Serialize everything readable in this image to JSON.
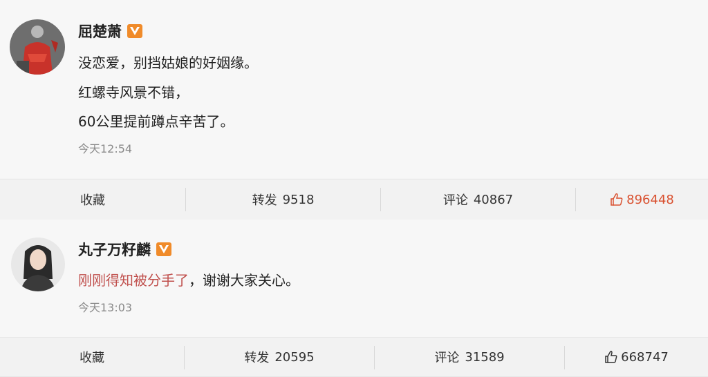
{
  "posts": [
    {
      "username": "屈楚萧",
      "lines": [
        "没恋爱，别挡姑娘的好姻缘。",
        "红螺寺风景不错，",
        "60公里提前蹲点辛苦了。"
      ],
      "time": "今天12:54",
      "actions": {
        "favorite": "收藏",
        "repost_label": "转发",
        "repost_count": "9518",
        "comment_label": "评论",
        "comment_count": "40867",
        "like_count": "896448"
      }
    },
    {
      "username": "丸子万籽麟",
      "line_highlight": "刚刚得知被分手了",
      "line_rest": "，谢谢大家关心。",
      "time": "今天13:03",
      "actions": {
        "favorite": "收藏",
        "repost_label": "转发",
        "repost_count": "20595",
        "comment_label": "评论",
        "comment_count": "31589",
        "like_count": "668747"
      }
    }
  ],
  "icons": {
    "verified_badge": "verified-v-badge-icon",
    "like": "thumbs-up-icon"
  },
  "colors": {
    "highlight_text": "#c0504d",
    "liked_red": "#d9502f",
    "badge_orange": "#f08b2a"
  }
}
